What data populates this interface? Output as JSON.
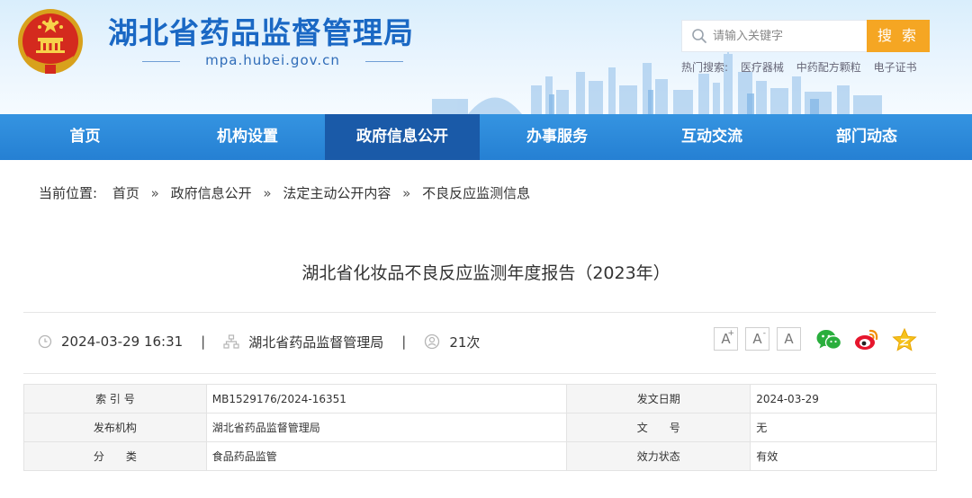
{
  "header": {
    "site_title": "湖北省药品监督管理局",
    "site_domain": "mpa.hubei.gov.cn",
    "search_placeholder": "请输入关键字",
    "search_button": "搜 索",
    "hot_label": "热门搜索:",
    "hot_links": [
      "医疗器械",
      "中药配方颗粒",
      "电子证书"
    ]
  },
  "nav": {
    "items": [
      "首页",
      "机构设置",
      "政府信息公开",
      "办事服务",
      "互动交流",
      "部门动态"
    ],
    "active_index": 2
  },
  "breadcrumb": {
    "label": "当前位置:",
    "items": [
      "首页",
      "政府信息公开",
      "法定主动公开内容",
      "不良反应监测信息"
    ],
    "separator": "»"
  },
  "article": {
    "title": "湖北省化妆品不良反应监测年度报告（2023年）",
    "datetime": "2024-03-29 16:31",
    "source": "湖北省药品监督管理局",
    "views": "21次",
    "divider": "|",
    "font_buttons": [
      "A",
      "A",
      "A"
    ]
  },
  "info_table": {
    "rows": [
      {
        "l1": "索 引 号",
        "v1": "MB1529176/2024-16351",
        "l2": "发文日期",
        "v2": "2024-03-29"
      },
      {
        "l1": "发布机构",
        "v1": "湖北省药品监督管理局",
        "l2": "文　　号",
        "v2": "无"
      },
      {
        "l1": "分　　类",
        "v1": "食品药品监管",
        "l2": "效力状态",
        "v2": "有效"
      }
    ]
  },
  "colors": {
    "brand_blue": "#1a68c4",
    "nav_blue": "#2580d3",
    "nav_active": "#1a5aa8",
    "search_orange": "#f5a623"
  },
  "icons": [
    "national-emblem-icon",
    "search-icon",
    "clock-icon",
    "org-icon",
    "user-icon",
    "wechat-icon",
    "weibo-icon",
    "favorite-star-icon"
  ]
}
